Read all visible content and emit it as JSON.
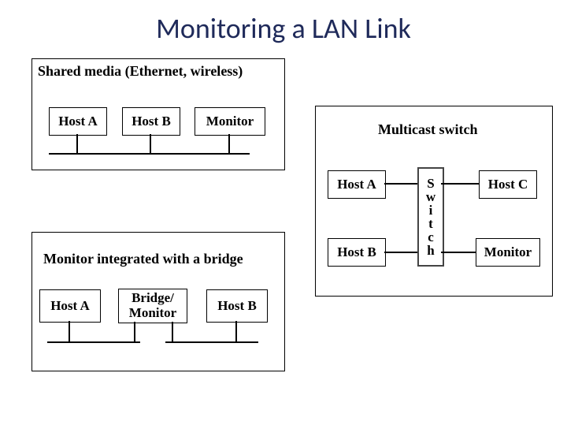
{
  "title": "Monitoring a LAN Link",
  "panels": {
    "shared": {
      "caption": "Shared media (Ethernet, wireless)",
      "hostA": "Host A",
      "hostB": "Host B",
      "monitor": "Monitor"
    },
    "bridge": {
      "caption": "Monitor integrated with a bridge",
      "hostA": "Host A",
      "bridge": "Bridge/\nMonitor",
      "hostB": "Host B"
    },
    "multicast": {
      "caption": "Multicast switch",
      "hostA": "Host A",
      "hostB": "Host B",
      "hostC": "Host C",
      "monitor": "Monitor",
      "switch": "Switch"
    }
  }
}
